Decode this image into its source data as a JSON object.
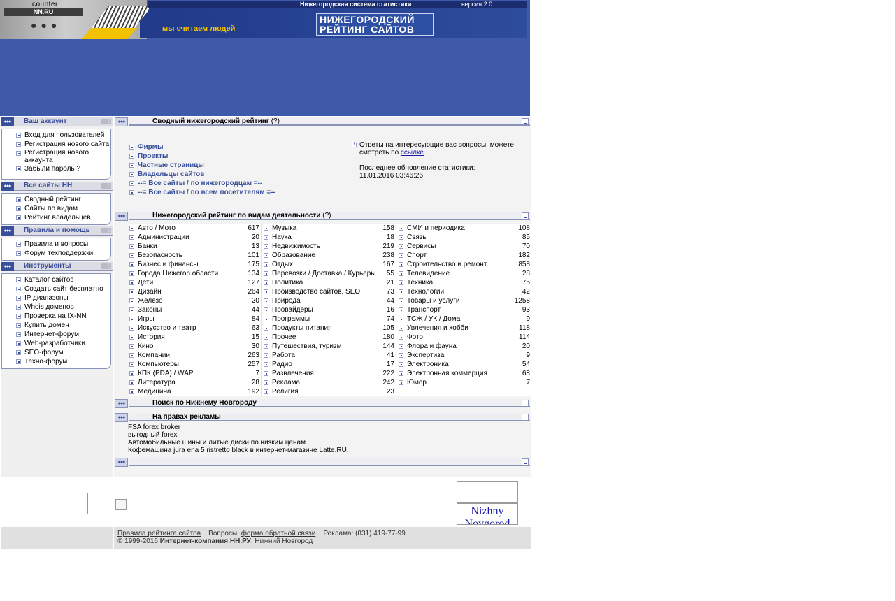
{
  "header": {
    "counter": "counter",
    "nnru": "NN.RU",
    "system": "Нижегородская система статистики",
    "version": "версия 2.0",
    "slogan": "мы считаем людей",
    "logo_line1": "НИЖЕГОРОДСКИЙ",
    "logo_line2": "РЕЙТИНГ САЙТОВ"
  },
  "sidebar": {
    "account": {
      "title": "Ваш аккаунт",
      "items": [
        "Вход для пользователей",
        "Регистрация нового сайта",
        "Регистрация нового аккаунта",
        "Забыли пароль ?"
      ]
    },
    "all_sites": {
      "title": "Все сайты НН",
      "items": [
        "Сводный рейтинг",
        "Сайты по видам",
        "Рейтинг владельцев"
      ]
    },
    "rules": {
      "title": "Правила и помощь",
      "items": [
        "Правила и вопросы",
        "Форум техподдержки"
      ]
    },
    "tools": {
      "title": "Инструменты",
      "items": [
        "Каталог сайтов",
        "Создать сайт бесплатно",
        "IP диапазоны",
        "Whois доменов",
        "Проверка на IX-NN",
        "Купить домен",
        "Интернет-форум",
        "Web-разработчики",
        "SEO-форум",
        "Техно-форум"
      ]
    }
  },
  "summary": {
    "title": "Сводный нижегородский рейтинг",
    "help": "(?)",
    "links": [
      "Фирмы",
      "Проекты",
      "Частные страницы",
      "Владельцы сайтов",
      "--= Все сайты / по нижегородцам =--",
      "--= Все сайты / по всем посетителям =--"
    ],
    "info_text": "Ответы на интересующие вас вопросы, можете смотреть по",
    "info_link": "ссылке",
    "info_dot": ".",
    "updated_label": "Последнее обновление статистики:",
    "updated_value": "11.01.2016 03:46:26"
  },
  "categories": {
    "title": "Нижегородский рейтинг по видам деятельности",
    "help": "(?)",
    "col1": [
      {
        "name": "Авто / Мото",
        "count": "617"
      },
      {
        "name": "Администрации",
        "count": "20"
      },
      {
        "name": "Банки",
        "count": "13"
      },
      {
        "name": "Безопасность",
        "count": "101"
      },
      {
        "name": "Бизнес и финансы",
        "count": "175"
      },
      {
        "name": "Города Нижегор.области",
        "count": "134"
      },
      {
        "name": "Дети",
        "count": "127"
      },
      {
        "name": "Дизайн",
        "count": "264"
      },
      {
        "name": "Железо",
        "count": "20"
      },
      {
        "name": "Законы",
        "count": "44"
      },
      {
        "name": "Игры",
        "count": "84"
      },
      {
        "name": "Искусство и театр",
        "count": "63"
      },
      {
        "name": "История",
        "count": "15"
      },
      {
        "name": "Кино",
        "count": "30"
      },
      {
        "name": "Компании",
        "count": "263"
      },
      {
        "name": "Компьютеры",
        "count": "257"
      },
      {
        "name": "КПК (PDA) / WAP",
        "count": "7"
      },
      {
        "name": "Литература",
        "count": "28"
      },
      {
        "name": "Медицина",
        "count": "192"
      }
    ],
    "col2": [
      {
        "name": "Музыка",
        "count": "158"
      },
      {
        "name": "Наука",
        "count": "18"
      },
      {
        "name": "Недвижимость",
        "count": "219"
      },
      {
        "name": "Образование",
        "count": "238"
      },
      {
        "name": "Отдых",
        "count": "167"
      },
      {
        "name": "Перевозки / Доставка / Курьеры",
        "count": "55"
      },
      {
        "name": "Политика",
        "count": "21"
      },
      {
        "name": "Производство сайтов, SEO",
        "count": "73"
      },
      {
        "name": "Природа",
        "count": "44"
      },
      {
        "name": "Провайдеры",
        "count": "16"
      },
      {
        "name": "Программы",
        "count": "74"
      },
      {
        "name": "Продукты питания",
        "count": "105"
      },
      {
        "name": "Прочее",
        "count": "180"
      },
      {
        "name": "Путешествия, туризм",
        "count": "144"
      },
      {
        "name": "Работа",
        "count": "41"
      },
      {
        "name": "Радио",
        "count": "17"
      },
      {
        "name": "Развлечения",
        "count": "222"
      },
      {
        "name": "Реклама",
        "count": "242"
      },
      {
        "name": "Религия",
        "count": "23"
      }
    ],
    "col3": [
      {
        "name": "СМИ и периодика",
        "count": "108"
      },
      {
        "name": "Связь",
        "count": "85"
      },
      {
        "name": "Сервисы",
        "count": "70"
      },
      {
        "name": "Спорт",
        "count": "182"
      },
      {
        "name": "Строительство и ремонт",
        "count": "858"
      },
      {
        "name": "Телевидение",
        "count": "28"
      },
      {
        "name": "Техника",
        "count": "75"
      },
      {
        "name": "Технологии",
        "count": "42"
      },
      {
        "name": "Товары и услуги",
        "count": "1258"
      },
      {
        "name": "Транспорт",
        "count": "93"
      },
      {
        "name": "ТСЖ / УК / Дома",
        "count": "9"
      },
      {
        "name": "Увлечения и хобби",
        "count": "118"
      },
      {
        "name": "Фото",
        "count": "114"
      },
      {
        "name": "Флора и фауна",
        "count": "20"
      },
      {
        "name": "Экспертиза",
        "count": "9"
      },
      {
        "name": "Электроника",
        "count": "54"
      },
      {
        "name": "Электронная коммерция",
        "count": "68"
      },
      {
        "name": "Юмор",
        "count": "7"
      }
    ]
  },
  "search": {
    "title": "Поиск по Нижнему Новгороду"
  },
  "ads": {
    "title": "На правах рекламы",
    "items": [
      "FSA forex broker",
      "выгодный forex",
      "Автомобильные шины и литые диски по низким ценам",
      "Кофемашина jura ena 5 ristretto black в интернет-магазине Latte.RU."
    ]
  },
  "banners": {
    "nizhny": "Nizhny Novgorod"
  },
  "footer": {
    "rules_link": "Правила рейтинга сайтов",
    "questions_label": "Вопросы:",
    "feedback_link": "форма обратной связи",
    "ads_contact": "Реклама: (831) 419-77-99",
    "copyright": "© 1999-2016",
    "company": "Интернет-компания НН.РУ",
    "city": ", Нижний Новгород"
  },
  "colors": {
    "header_blue": "#3f5aa8",
    "accent": "#3a4f9a",
    "link": "#1a1aa6"
  }
}
